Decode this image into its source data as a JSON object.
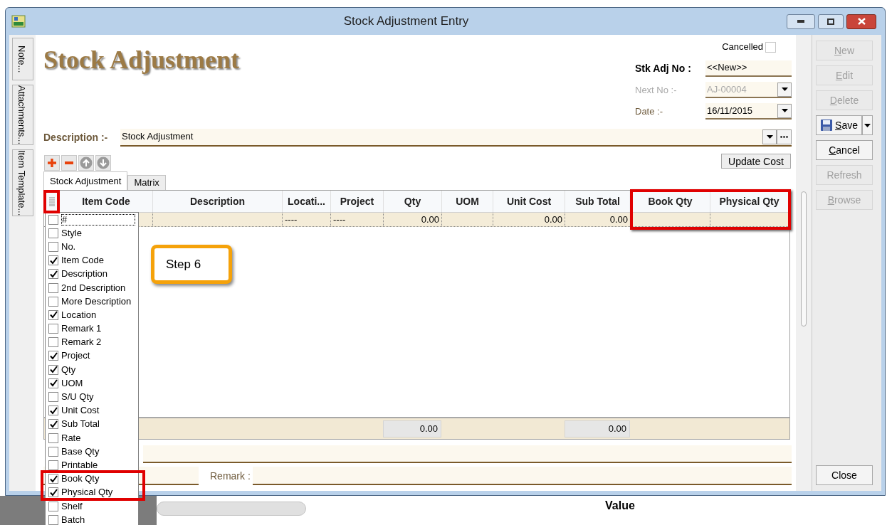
{
  "window": {
    "title": "Stock Adjustment Entry"
  },
  "side_tabs": [
    {
      "label": "Note..."
    },
    {
      "label": "Attachments..."
    },
    {
      "label": "Item Template..."
    }
  ],
  "heading": "Stock Adjustment",
  "cancelled": {
    "label": "Cancelled",
    "checked": false
  },
  "fields": [
    {
      "label": "Stk Adj No :",
      "value": "<<New>>",
      "bold": true,
      "dropdown": false,
      "disabled": false
    },
    {
      "label": "Next No :-",
      "value": "AJ-00004",
      "bold": false,
      "dropdown": true,
      "disabled": true
    },
    {
      "label": "Date :-",
      "value": "16/11/2015",
      "bold": false,
      "dropdown": true,
      "disabled": false
    }
  ],
  "description": {
    "label": "Description :-",
    "value": "Stock Adjustment"
  },
  "update_cost": "Update Cost",
  "tabs": [
    {
      "label": "Stock Adjustment",
      "selected": true
    },
    {
      "label": "Matrix",
      "selected": false
    }
  ],
  "table": {
    "columns": [
      "Item Code",
      "Description",
      "Locati...",
      "Project",
      "Qty",
      "UOM",
      "Unit Cost",
      "Sub Total",
      "Book Qty",
      "Physical Qty"
    ],
    "rows": [
      {
        "cells": [
          null,
          null,
          "----",
          "----",
          "0.00",
          null,
          "0.00",
          "0.00",
          null,
          null
        ]
      }
    ],
    "totals": {
      "qty": "0.00",
      "sub_total": "0.00"
    }
  },
  "footer": {
    "remark_label": "Remark :"
  },
  "actions": [
    {
      "label": "New",
      "underline_first": true,
      "disabled": true,
      "kind": "plain"
    },
    {
      "label": "Edit",
      "underline_first": true,
      "disabled": true,
      "kind": "plain"
    },
    {
      "label": "Delete",
      "underline_first": true,
      "disabled": true,
      "kind": "plain"
    },
    {
      "label": "Save",
      "underline_first": true,
      "disabled": false,
      "kind": "split"
    },
    {
      "label": "Cancel",
      "underline_first": true,
      "disabled": false,
      "kind": "plain"
    },
    {
      "label": "Refresh",
      "underline_first": false,
      "disabled": true,
      "kind": "plain"
    },
    {
      "label": "Browse",
      "underline_first": true,
      "disabled": true,
      "kind": "plain"
    }
  ],
  "close": {
    "label": "Close"
  },
  "column_menu": {
    "items": [
      {
        "label": "#",
        "checked": false
      },
      {
        "label": "Style",
        "checked": false
      },
      {
        "label": "No.",
        "checked": false
      },
      {
        "label": "Item Code",
        "checked": true
      },
      {
        "label": "Description",
        "checked": true
      },
      {
        "label": "2nd Description",
        "checked": false
      },
      {
        "label": "More Description",
        "checked": false
      },
      {
        "label": "Location",
        "checked": true
      },
      {
        "label": "Remark 1",
        "checked": false
      },
      {
        "label": "Remark 2",
        "checked": false
      },
      {
        "label": "Project",
        "checked": true
      },
      {
        "label": "Qty",
        "checked": true
      },
      {
        "label": "UOM",
        "checked": true
      },
      {
        "label": "S/U Qty",
        "checked": false
      },
      {
        "label": "Unit Cost",
        "checked": true
      },
      {
        "label": "Sub Total",
        "checked": true
      },
      {
        "label": "Rate",
        "checked": false
      },
      {
        "label": "Base Qty",
        "checked": false
      },
      {
        "label": "Printable",
        "checked": false
      },
      {
        "label": "Book Qty",
        "checked": true
      },
      {
        "label": "Physical Qty",
        "checked": true
      },
      {
        "label": "Shelf",
        "checked": false
      },
      {
        "label": "Batch",
        "checked": false
      }
    ]
  },
  "callout": "Step 6",
  "background": {
    "caption": "Value"
  }
}
